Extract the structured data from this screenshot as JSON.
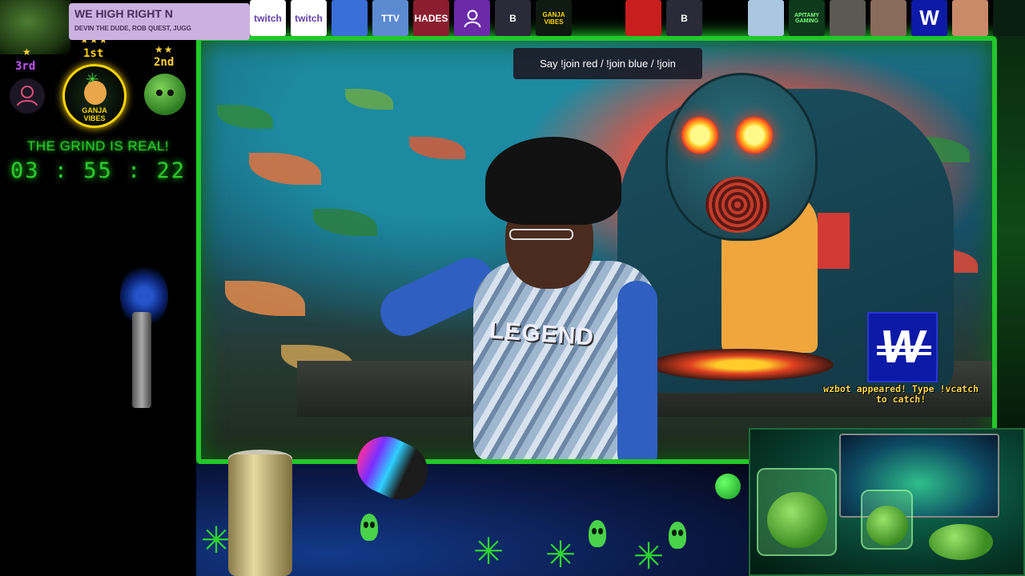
{
  "now_playing": {
    "title": "WE HIGH RIGHT N",
    "names": "DEVIN THE DUDE, ROB QUEST, JUGG"
  },
  "leaderboard": {
    "first_label": "1st",
    "second_label": "2nd",
    "third_label": "3rd",
    "first_stars": "★★★",
    "second_stars": "★★",
    "third_stars": "★",
    "logo_text_line1": "GANJA",
    "logo_text_line2": "VIBES"
  },
  "grind": {
    "message": "THE GRIND IS REAL!",
    "timer": "03 : 55 : 22"
  },
  "top_avatars": [
    {
      "label": "twitch",
      "bg": "#ffffff",
      "fg": "#6441a5"
    },
    {
      "label": "twitch",
      "bg": "#ffffff",
      "fg": "#6441a5"
    },
    {
      "label": "",
      "bg": "#3a6fd8",
      "fg": "#ffffff"
    },
    {
      "label": "TTV",
      "bg": "#5c8ad0",
      "fg": "#ffffff"
    },
    {
      "label": "HADES",
      "bg": "#8a1e2e",
      "fg": "#ffffff"
    },
    {
      "label": "",
      "bg": "#6b2aa8",
      "fg": "#ffffff"
    },
    {
      "label": "B",
      "bg": "#2a2a38",
      "fg": "#ffffff"
    },
    {
      "label": "GANJA VIBES",
      "bg": "#0f1a0f",
      "fg": "#ffd500"
    },
    {
      "label": "",
      "bg": "#c81e1e",
      "fg": "#ffffff"
    },
    {
      "label": "B",
      "bg": "#2a2a38",
      "fg": "#ffffff"
    },
    {
      "label": "",
      "bg": "#aac6e0",
      "fg": "#ffffff"
    },
    {
      "label": "APITAMY GAMING",
      "bg": "#0e3a1c",
      "fg": "#7dff7d"
    },
    {
      "label": "",
      "bg": "#5a5a52",
      "fg": "#ffffff"
    },
    {
      "label": "",
      "bg": "#8a6a5a",
      "fg": "#ffffff"
    },
    {
      "label": "W",
      "bg": "#0d1aa8",
      "fg": "#ffffff"
    },
    {
      "label": "",
      "bg": "#c98a6a",
      "fg": "#ffffff"
    },
    {
      "label": "",
      "bg": "#0a1f12",
      "fg": "#7dff7d"
    }
  ],
  "chat_hint": {
    "text": "Say !join red / !join blue / !join"
  },
  "wzbot": {
    "logo_letter": "W",
    "line1": "wzbot appeared! Type !vcatch",
    "line2": "to catch!"
  },
  "scene": {
    "shirt_text": "LEGEND"
  },
  "colors": {
    "accent_green": "#2ecc2e",
    "first_gold": "#ffd500",
    "first_label": "#ffd500",
    "second_label": "#ffd23a",
    "third_label": "#c455ff",
    "wz_blue": "#0d1aa8",
    "wz_text": "#ffd84a"
  }
}
